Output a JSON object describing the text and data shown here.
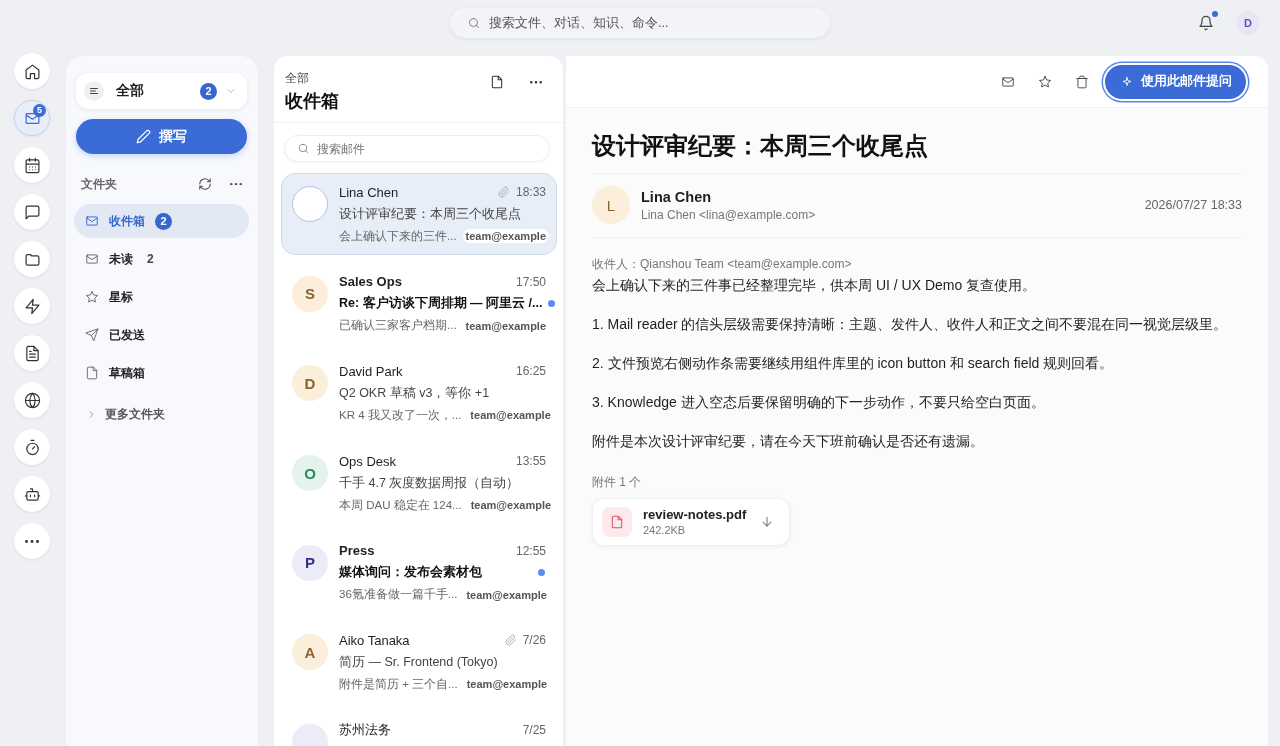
{
  "top_bar": {
    "search": {
      "placeholder": "搜索文件、对话、知识、命令..."
    },
    "notifications": {
      "has_new": true
    },
    "avatar": "D"
  },
  "rail": {
    "items": [
      {
        "kind": "home",
        "selected": false
      },
      {
        "kind": "mail",
        "selected": true,
        "badge": "5"
      },
      {
        "kind": "calendar",
        "selected": false
      },
      {
        "kind": "chat",
        "selected": false
      },
      {
        "kind": "folder",
        "selected": false
      },
      {
        "kind": "bolt",
        "selected": false
      },
      {
        "kind": "document",
        "selected": false
      },
      {
        "kind": "globe",
        "selected": false
      },
      {
        "kind": "timer",
        "selected": false
      },
      {
        "kind": "robot",
        "selected": false
      },
      {
        "kind": "more",
        "selected": false
      }
    ]
  },
  "folders_panel": {
    "scope": {
      "label": "全部",
      "count": "2"
    },
    "compose_button": "撰写",
    "section_title": "文件夹",
    "folders": [
      {
        "kind": "inbox",
        "label": "收件箱",
        "count": "2",
        "selected": true
      },
      {
        "kind": "unread",
        "label": "未读",
        "count": "2",
        "selected": false
      },
      {
        "kind": "starred",
        "label": "星标",
        "selected": false
      },
      {
        "kind": "sent",
        "label": "已发送",
        "selected": false
      },
      {
        "kind": "drafts",
        "label": "草稿箱",
        "selected": false
      }
    ],
    "more_folders": "更多文件夹"
  },
  "mail_list": {
    "scope": "全部",
    "title": "收件箱",
    "search": {
      "placeholder": "搜索邮件"
    },
    "mails": [
      {
        "sender": "Lina Chen",
        "time": "18:33",
        "attachment": true,
        "subject": "设计评审纪要：本周三个收尾点",
        "unread": false,
        "preview": "会上确认下来的三件...",
        "recipient": "team@example",
        "selected": true
      },
      {
        "sender": "Sales Ops",
        "initial": "S",
        "color": "#fbeedb",
        "time": "17:50",
        "attachment": false,
        "subject": "Re: 客户访谈下周排期 — 阿里云 /...",
        "unread": true,
        "preview": "已确认三家客户档期...",
        "recipient": "team@example",
        "selected": false
      },
      {
        "sender": "David Park",
        "initial": "D",
        "color": "#fbeedb",
        "time": "16:25",
        "attachment": false,
        "subject": "Q2 OKR 草稿 v3，等你 +1",
        "unread": false,
        "preview": "KR 4 我又改了一次，...",
        "recipient": "team@example",
        "selected": false
      },
      {
        "sender": "Ops Desk",
        "initial": "O",
        "color": "#e4f3ec",
        "time": "13:55",
        "attachment": false,
        "subject": "千手 4.7 灰度数据周报（自动）",
        "unread": false,
        "preview": "本周 DAU 稳定在 124...",
        "recipient": "team@example",
        "selected": false
      },
      {
        "sender": "Press",
        "initial": "P",
        "color": "#ecebf8",
        "time": "12:55",
        "attachment": false,
        "subject": "媒体询问：发布会素材包",
        "unread": true,
        "preview": "36氪准备做一篇千手...",
        "recipient": "team@example",
        "selected": false
      },
      {
        "sender": "Aiko Tanaka",
        "initial": "A",
        "color": "#fbeedb",
        "time": "7/26",
        "attachment": true,
        "subject": "简历 — Sr. Frontend (Tokyo)",
        "unread": false,
        "preview": "附件是简历 + 三个自...",
        "recipient": "team@example",
        "selected": false
      },
      {
        "sender": "苏州法务",
        "color": "#ecebf8",
        "time": "7/25",
        "selected": false
      }
    ]
  },
  "reader": {
    "actions": {
      "ask_button": "使用此邮件提问"
    },
    "subject": "设计评审纪要：本周三个收尾点",
    "sender": {
      "initial": "L",
      "color": "#fbeedb",
      "name": "Lina Chen",
      "address": "Lina Chen <lina@example.com>"
    },
    "date": "2026/07/27 18:33",
    "recipients": "收件人：Qianshou Team <team@example.com>",
    "body": [
      "会上确认下来的三件事已经整理完毕，供本周 UI / UX Demo 复查使用。",
      "1. Mail reader 的信头层级需要保持清晰：主题、发件人、收件人和正文之间不要混在同一视觉层级里。",
      "2. 文件预览右侧动作条需要继续用组件库里的 icon button 和 search field 规则回看。",
      "3. Knowledge 进入空态后要保留明确的下一步动作，不要只给空白页面。",
      "附件是本次设计评审纪要，请在今天下班前确认是否还有遗漏。"
    ],
    "attachments_label": "附件 1 个",
    "attachments": [
      {
        "name": "review-notes.pdf",
        "size": "242.2KB"
      }
    ]
  }
}
